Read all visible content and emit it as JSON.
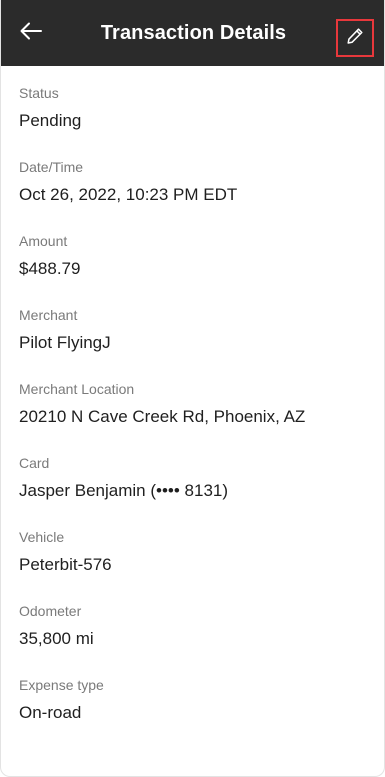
{
  "header": {
    "title": "Transaction Details",
    "back_icon": "arrow-left-icon",
    "edit_icon": "pencil-icon",
    "background": "#2b2b2b",
    "edit_highlight": "#e8383c"
  },
  "fields": [
    {
      "label": "Status",
      "value": "Pending"
    },
    {
      "label": "Date/Time",
      "value": "Oct 26, 2022, 10:23 PM EDT"
    },
    {
      "label": "Amount",
      "value": "$488.79"
    },
    {
      "label": "Merchant",
      "value": "Pilot FlyingJ"
    },
    {
      "label": "Merchant Location",
      "value": "20210 N Cave Creek Rd, Phoenix, AZ"
    },
    {
      "label": "Card",
      "value": "Jasper Benjamin (•••• 8131)"
    },
    {
      "label": "Vehicle",
      "value": "Peterbit-576"
    },
    {
      "label": "Odometer",
      "value": "35,800 mi"
    },
    {
      "label": "Expense type",
      "value": "On-road"
    }
  ]
}
